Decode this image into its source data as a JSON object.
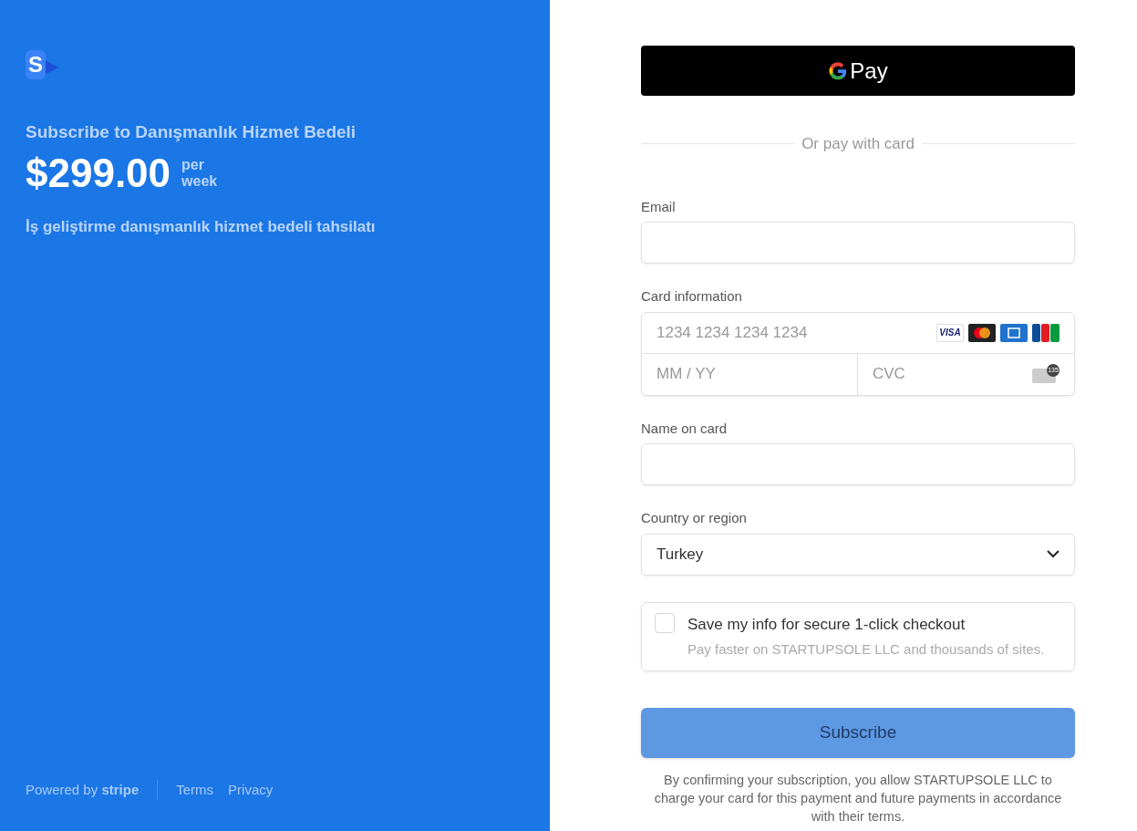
{
  "merchant": {
    "logo_letter": "S",
    "title": "Subscribe to Danışmanlık Hizmet Bedeli",
    "price": "$299.00",
    "period_line1": "per",
    "period_line2": "week",
    "description": "İş geliştirme danışmanlık hizmet bedeli tahsilatı"
  },
  "footer": {
    "powered": "Powered by **stripe**",
    "links": [
      "Terms",
      "Privacy"
    ]
  },
  "gpay": {
    "label": "Pay"
  },
  "divider": "Or pay with card",
  "email": {
    "label": "Email"
  },
  "card": {
    "label": "Card information",
    "number_placeholder": "1234 1234 1234 1234",
    "expiry_placeholder": "MM / YY",
    "cvc_placeholder": "CVC",
    "brand_visa": "VISA",
    "cvc_badge": "135"
  },
  "name": {
    "label": "Name on card"
  },
  "country": {
    "label": "Country or region",
    "value": "Turkey"
  },
  "save_info": {
    "checked": false,
    "title": "Save my info for secure 1-click checkout",
    "subtitle": "Pay faster on STARTUPSOLE LLC and thousands of sites."
  },
  "submit": {
    "label": "Subscribe",
    "disabled": true
  },
  "legal": "By confirming your subscription, you allow STARTUPSOLE LLC to charge your card for this payment and future payments in accordance with their terms."
}
